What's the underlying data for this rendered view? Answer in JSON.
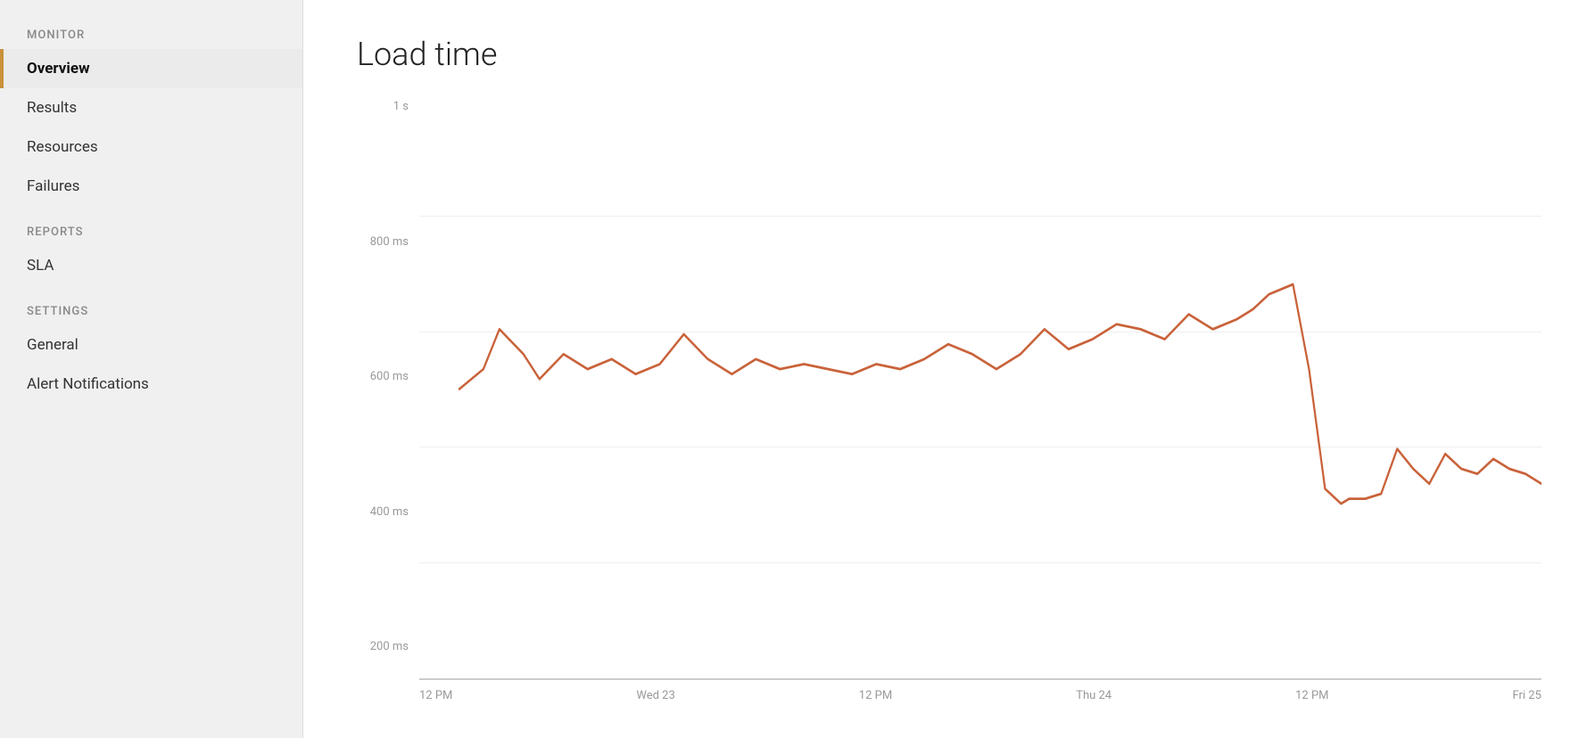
{
  "sidebar": {
    "sections": [
      {
        "label": "MONITOR",
        "items": [
          {
            "id": "overview",
            "label": "Overview",
            "active": true
          },
          {
            "id": "results",
            "label": "Results",
            "active": false
          },
          {
            "id": "resources",
            "label": "Resources",
            "active": false
          },
          {
            "id": "failures",
            "label": "Failures",
            "active": false
          }
        ]
      },
      {
        "label": "REPORTS",
        "items": [
          {
            "id": "sla",
            "label": "SLA",
            "active": false
          }
        ]
      },
      {
        "label": "SETTINGS",
        "items": [
          {
            "id": "general",
            "label": "General",
            "active": false
          },
          {
            "id": "alert-notifications",
            "label": "Alert Notifications",
            "active": false
          }
        ]
      }
    ]
  },
  "chart": {
    "title": "Load time",
    "y_labels": [
      "1 s",
      "800 ms",
      "600 ms",
      "400 ms",
      "200 ms"
    ],
    "x_labels": [
      "12 PM",
      "Wed 23",
      "12 PM",
      "Thu 24",
      "12 PM",
      "Fri 25"
    ],
    "accent_color": "#c9623a",
    "line_color": "#c9623a"
  }
}
